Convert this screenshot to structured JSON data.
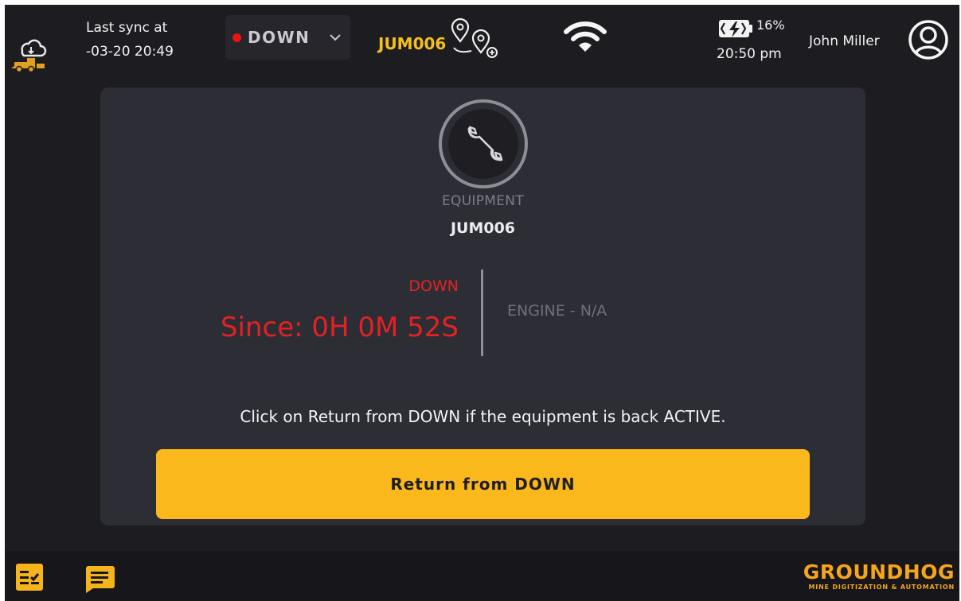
{
  "header": {
    "sync_label": "Last sync at",
    "sync_time": "-03-20 20:49",
    "status": "DOWN",
    "status_color": "#e81515",
    "equipment_code": "JUM006",
    "battery_percent": "16%",
    "clock": "20:50 pm",
    "user_name": "John Miller",
    "icons": [
      "cloud-truck-logo-icon",
      "location-pins-icon",
      "wifi-icon",
      "battery-charging-icon",
      "user-avatar-icon"
    ]
  },
  "card": {
    "icon": "wrench-icon",
    "equipment_label": "EQUIPMENT",
    "equipment_name": "JUM006",
    "status_word": "DOWN",
    "since_text": "Since: 0H 0M 52S",
    "engine_text": "ENGINE - N/A",
    "instruction": "Click on Return from DOWN if the equipment is back ACTIVE.",
    "return_button_label": "Return from DOWN"
  },
  "footer": {
    "icons": [
      "checklist-icon",
      "chat-icon"
    ],
    "brand_name": "GROUNDHOG",
    "brand_tagline": "MINE DIGITIZATION & AUTOMATION"
  },
  "colors": {
    "accent": "#fbb81d",
    "alert": "#e52222",
    "background": "#1c1c21",
    "card": "#2c2d35"
  }
}
